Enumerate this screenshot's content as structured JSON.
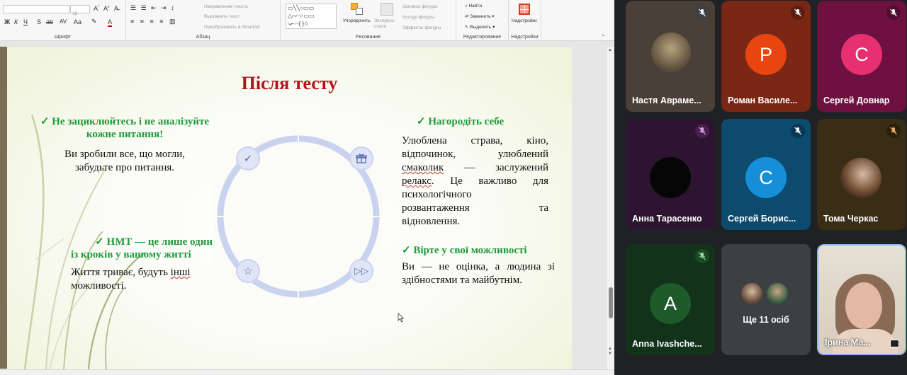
{
  "ribbon": {
    "font_group": "Шрифт",
    "font_size": "18",
    "paragraph_group": "Абзац",
    "text_direction": "Направление текста",
    "align_text": "Выровнять текст",
    "smartart": "Преобразовать в SmartArt",
    "drawing_group": "Рисование",
    "arrange": "Упорядочить",
    "quick_styles": "Экспресс-стили",
    "shape_fill": "Заливка фигуры",
    "shape_outline": "Контур фигуры",
    "shape_effects": "Эффекты фигуры",
    "find": "Найти",
    "replace": "Заменить",
    "select": "Выделить",
    "editing_group": "Редактирование",
    "addins": "Надстройки",
    "addins_group": "Надстройки"
  },
  "slide": {
    "title": "Після тесту",
    "left_top_heading_1": "✓ Не зациклюйтесь і не аналізуйте",
    "left_top_heading_2": "кожне питання!",
    "left_top_body_1": "Ви зробили все, що могли,",
    "left_top_body_2": "забудьте про питання.",
    "left_bottom_heading_1": "✓ НМТ — це лише один",
    "left_bottom_heading_2": "із кроків у вашому житті",
    "left_bottom_body_1a": "Життя триває, будуть ",
    "left_bottom_body_1b": "інші",
    "left_bottom_body_2": "можливості.",
    "right_top_heading": "✓ Нагородіть себе",
    "right_top_l1": "Улюблена страва, кіно,",
    "right_top_l2": "відпочинок, улюблений",
    "right_top_l3a": "смаколик",
    "right_top_l3b": " — заслужений",
    "right_top_l4a": "релакс",
    "right_top_l4b": ". Це важливо для",
    "right_top_l5": "психологічного",
    "right_top_l6": "розвантаження та",
    "right_top_l7": "відновлення.",
    "right_bottom_heading": "✓ Вірте у свої можливості",
    "right_bottom_l1": "Ви — не оцінка, а людина зі",
    "right_bottom_l2": "здібностями та майбутнім."
  },
  "meet": {
    "tiles": [
      {
        "name": "Настя Авраме...",
        "bg": "#4a4037"
      },
      {
        "name": "Роман Василе...",
        "bg": "#7a2716",
        "initial": "Р",
        "avatar_color": "#e8450f"
      },
      {
        "name": "Сергей Довнар",
        "bg": "#6f1140",
        "initial": "С",
        "avatar_color": "#e6306f"
      },
      {
        "name": "Анна Тарасенко",
        "bg": "#2d1430"
      },
      {
        "name": "Сергей Борис...",
        "bg": "#0c4a6e",
        "initial": "С",
        "avatar_color": "#1590d8"
      },
      {
        "name": "Тома Черкас",
        "bg": "#3a2d16"
      },
      {
        "name": "Anna Ivashche...",
        "bg": "#12331a",
        "initial": "A",
        "avatar_color": "#1e5a2a"
      },
      {
        "name": "Ще 11 осіб",
        "bg": "#3c4043"
      },
      {
        "name": "Ірина Ма...",
        "bg": "#cdbfae"
      }
    ]
  }
}
